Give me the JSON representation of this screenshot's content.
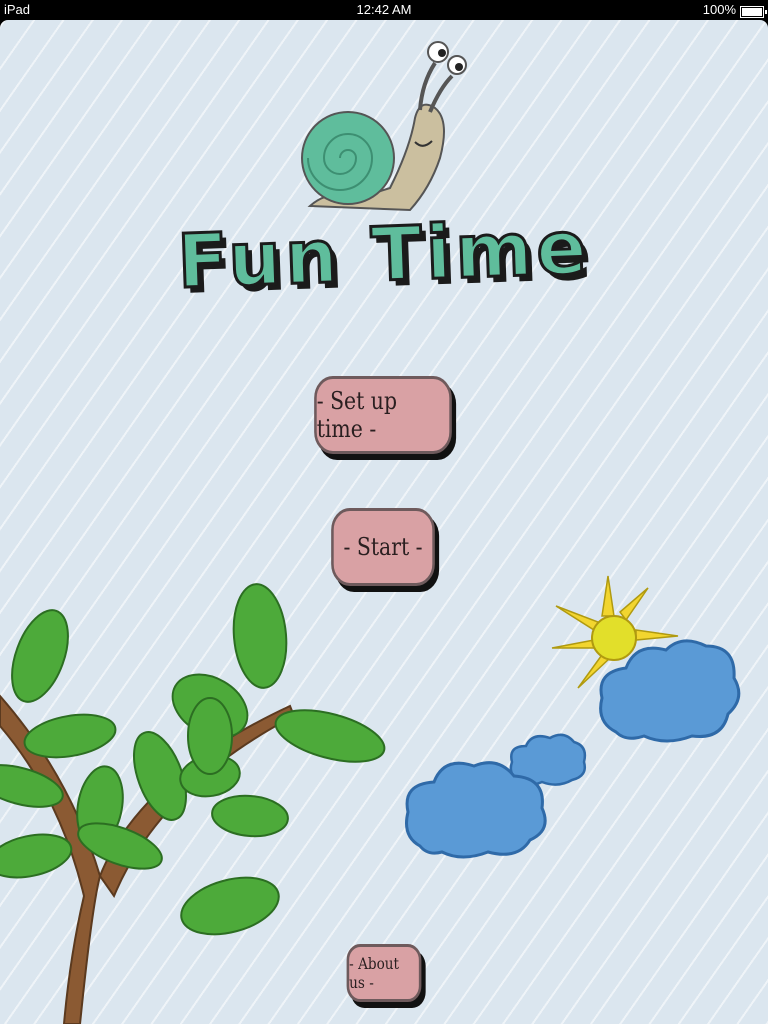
{
  "status_bar": {
    "device": "iPad",
    "time": "12:42 AM",
    "battery": "100%"
  },
  "app": {
    "title": "Fun Time"
  },
  "buttons": {
    "setup": "- Set up time -",
    "start": "- Start -",
    "about": "- About us -"
  },
  "icons": [
    "snail-icon",
    "tree-icon",
    "sun-icon",
    "cloud-icon"
  ]
}
